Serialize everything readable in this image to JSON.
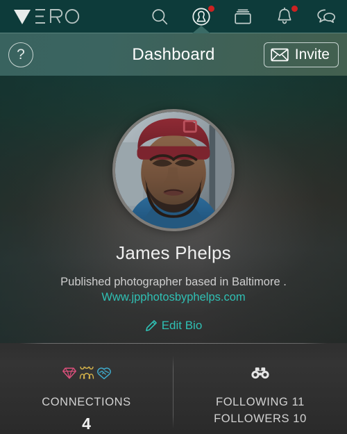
{
  "app": {
    "brand": "VERO",
    "accent_teal": "#2fc0b4",
    "topbar_color": "#0d3b3a",
    "badge_color": "#cc2222"
  },
  "topnav": {
    "items": [
      {
        "name": "search-icon",
        "label": "Search",
        "badge": false,
        "active": false
      },
      {
        "name": "profile-icon",
        "label": "Profile",
        "badge": true,
        "active": true
      },
      {
        "name": "collections-icon",
        "label": "Collections",
        "badge": false,
        "active": false
      },
      {
        "name": "notifications-icon",
        "label": "Notifications",
        "badge": true,
        "active": false
      },
      {
        "name": "messages-icon",
        "label": "Messages",
        "badge": false,
        "active": false
      }
    ]
  },
  "subheader": {
    "help_label": "?",
    "title": "Dashboard",
    "invite_label": "Invite",
    "invite_icon": "envelope-icon"
  },
  "profile": {
    "name": "James Phelps",
    "bio": "Published photographer based in Baltimore .",
    "url": "Www.jpphotosbyphelps.com",
    "edit_label": "Edit Bio",
    "edit_icon": "pencil-icon",
    "avatar_alt": "James Phelps profile photo"
  },
  "stats": {
    "connections": {
      "label": "CONNECTIONS",
      "value": "4",
      "icons": [
        {
          "name": "diamond-icon",
          "color": "#d94f7a"
        },
        {
          "name": "friends-icon",
          "color": "#d3b14a"
        },
        {
          "name": "handshake-icon",
          "color": "#3fa8c9"
        }
      ]
    },
    "following": {
      "icon": "binoculars-icon",
      "following_label": "FOLLOWING 11",
      "followers_label": "FOLLOWERS 10"
    }
  }
}
